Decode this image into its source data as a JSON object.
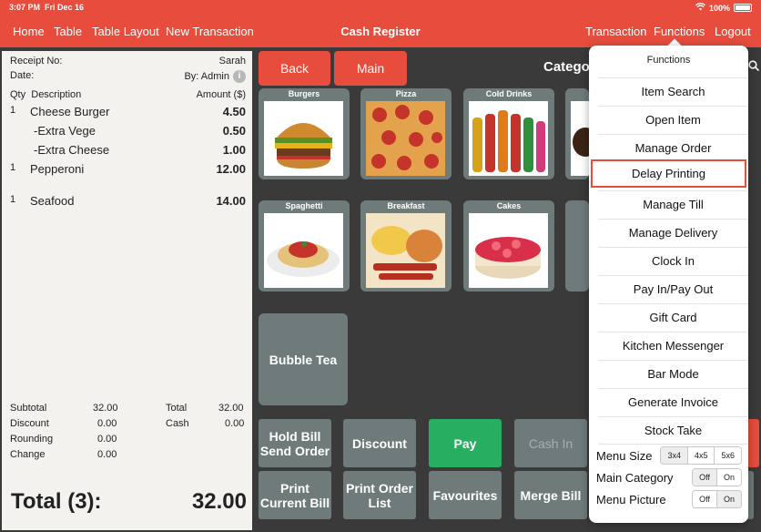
{
  "status": {
    "time": "3:07 PM",
    "date": "Fri Dec 16",
    "battery": "100%"
  },
  "nav": {
    "home": "Home",
    "table": "Table",
    "table_layout": "Table Layout",
    "new_transaction": "New Transaction",
    "title": "Cash Register",
    "transaction": "Transaction",
    "functions": "Functions",
    "logout": "Logout"
  },
  "receipt": {
    "receipt_no_label": "Receipt No:",
    "receipt_no_value": "Sarah",
    "date_label": "Date:",
    "by": "By: Admin",
    "col_qty": "Qty",
    "col_desc": "Description",
    "col_amount": "Amount ($)",
    "items": [
      {
        "qty": "1",
        "desc": "Cheese Burger",
        "amount": "4.50"
      },
      {
        "qty": "",
        "desc": "-Extra Vege",
        "amount": "0.50"
      },
      {
        "qty": "",
        "desc": "-Extra Cheese",
        "amount": "1.00"
      },
      {
        "qty": "1",
        "desc": "Pepperoni",
        "amount": "12.00"
      },
      {
        "qty": "1",
        "desc": "Seafood",
        "amount": "14.00"
      }
    ],
    "subtotal_label": "Subtotal",
    "subtotal": "32.00",
    "discount_label": "Discount",
    "discount": "0.00",
    "rounding_label": "Rounding",
    "rounding": "0.00",
    "change_label": "Change",
    "change": "0.00",
    "total_label": "Total",
    "total": "32.00",
    "cash_label": "Cash",
    "cash": "0.00",
    "grand_label": "Total (3):",
    "grand_value": "32.00"
  },
  "main": {
    "back": "Back",
    "main": "Main",
    "category_label": "Catego",
    "tiles": [
      {
        "label": "Burgers"
      },
      {
        "label": "Pizza"
      },
      {
        "label": "Cold Drinks"
      },
      {
        "label": "Spaghetti"
      },
      {
        "label": "Breakfast"
      },
      {
        "label": "Cakes"
      }
    ],
    "bubble_tea": "Bubble Tea",
    "hold_bill": "Hold Bill Send Order",
    "discount": "Discount",
    "pay": "Pay",
    "cash_in": "Cash In",
    "print_current_bill": "Print Current Bill",
    "print_order_list": "Print Order List",
    "favourites": "Favourites",
    "merge_bill": "Merge Bill"
  },
  "functions": {
    "title": "Functions",
    "items": [
      "Item Search",
      "Open Item",
      "Manage Order",
      "Delay Printing",
      "Manage Till",
      "Manage Delivery",
      "Clock In",
      "Pay In/Pay Out",
      "Gift Card",
      "Kitchen Messenger",
      "Bar Mode",
      "Generate Invoice",
      "Stock Take"
    ],
    "highlighted": "Delay Printing",
    "menu_size_label": "Menu Size",
    "menu_size_options": [
      "3x4",
      "4x5",
      "5x6"
    ],
    "menu_size_selected": "3x4",
    "main_category_label": "Main Category",
    "main_category_options": [
      "Off",
      "On"
    ],
    "main_category_selected": "Off",
    "menu_picture_label": "Menu Picture",
    "menu_picture_options": [
      "Off",
      "On"
    ],
    "menu_picture_selected": "On"
  },
  "colors": {
    "accent": "#e74c3c",
    "tile": "#6f7b7b",
    "pay": "#27ae60",
    "background": "#3a3a3a"
  }
}
